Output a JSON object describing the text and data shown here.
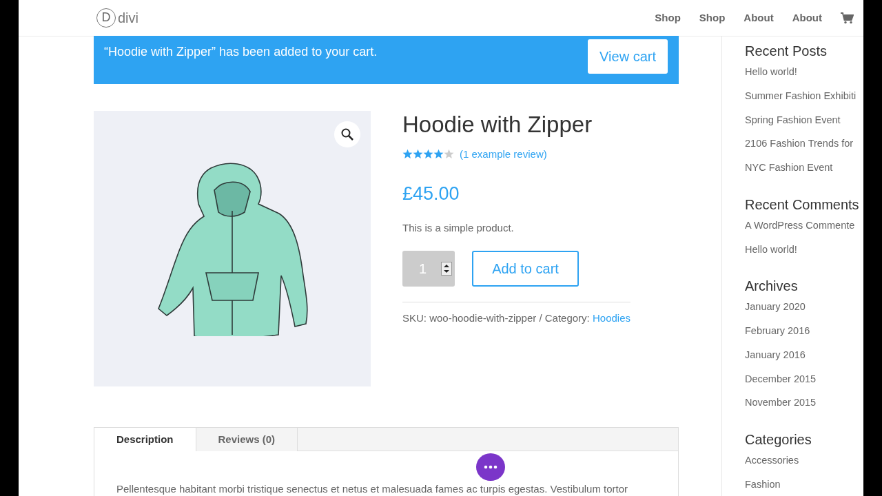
{
  "header": {
    "logo": {
      "letter": "D",
      "name": "divi"
    },
    "nav": [
      {
        "label": "Shop"
      },
      {
        "label": "Shop"
      },
      {
        "label": "About"
      },
      {
        "label": "About"
      }
    ]
  },
  "notice": {
    "message": "“Hoodie with Zipper” has been added to your cart.",
    "button": "View cart"
  },
  "product": {
    "title": "Hoodie with Zipper",
    "stars": 4,
    "review_link": "(1 example review)",
    "price": "£45.00",
    "short_description": "This is a simple product.",
    "quantity": "1",
    "add_button": "Add to cart",
    "meta": "SKU: woo-hoodie-with-zipper / Category:",
    "category": "Hoodies"
  },
  "tabs": [
    {
      "label": "Description",
      "selected": true
    },
    {
      "label": "Reviews (0)",
      "selected": false
    }
  ],
  "description": "Pellentesque habitant morbi tristique senectus et netus et malesuada fames ac turpis egestas. Vestibulum tortor",
  "sidebar": [
    {
      "title": "Recent Posts",
      "items": [
        "Hello world!",
        "Summer Fashion Exhibiti",
        "Spring Fashion Event",
        "2106 Fashion Trends for",
        "NYC Fashion Event"
      ]
    },
    {
      "title": "Recent Comments",
      "items": [
        "A WordPress Commente",
        "Hello world!"
      ]
    },
    {
      "title": "Archives",
      "items": [
        "January 2020",
        "February 2016",
        "January 2016",
        "December 2015",
        "November 2015"
      ]
    },
    {
      "title": "Categories",
      "items": [
        "Accessories",
        "Fashion"
      ]
    }
  ]
}
